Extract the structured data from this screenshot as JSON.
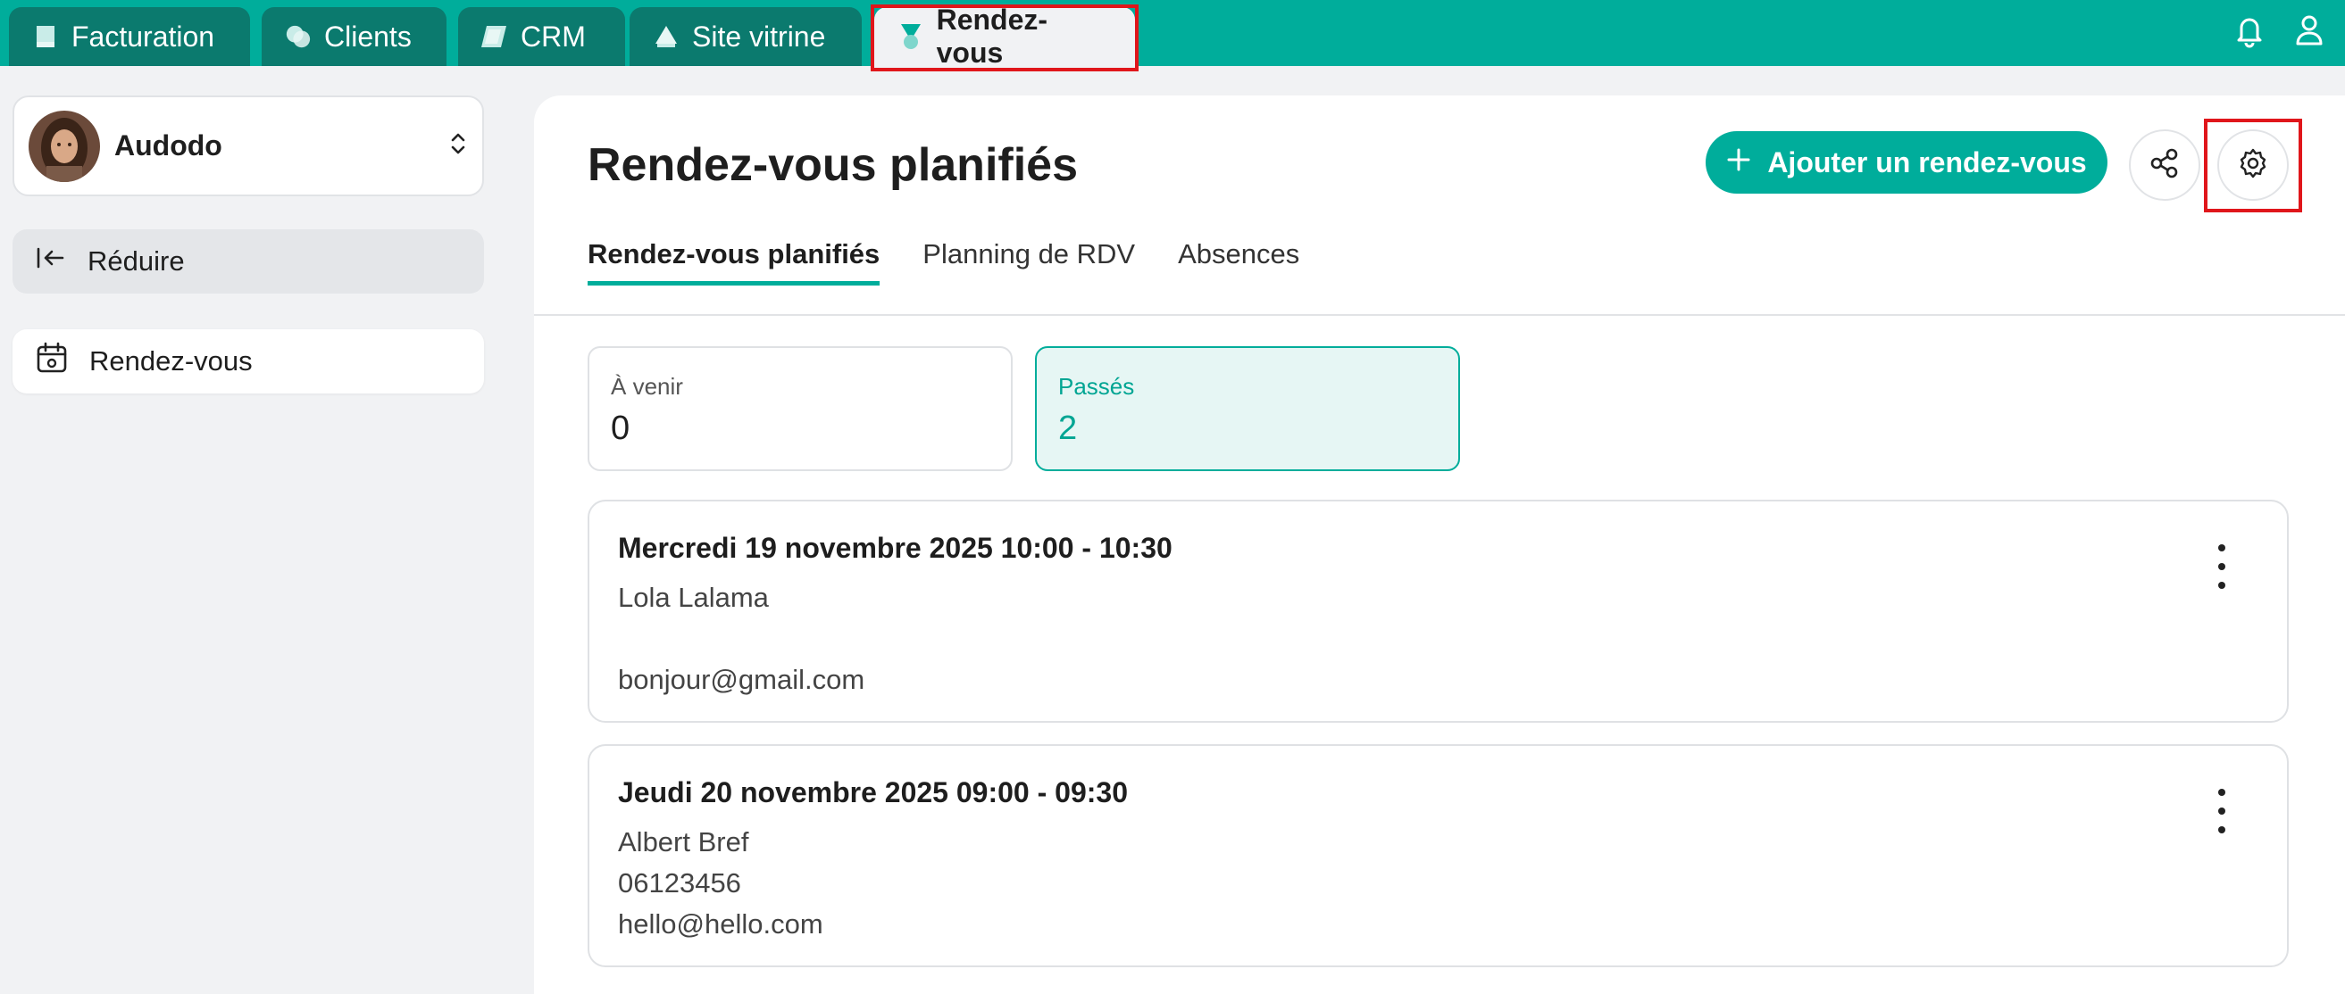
{
  "top_tabs": [
    {
      "label": "Facturation",
      "icon": "invoice-icon"
    },
    {
      "label": "Clients",
      "icon": "clients-icon"
    },
    {
      "label": "CRM",
      "icon": "crm-icon"
    },
    {
      "label": "Site vitrine",
      "icon": "site-icon"
    },
    {
      "label": "Rendez-vous",
      "icon": "appointment-icon",
      "active": true
    }
  ],
  "top_icons": [
    "bell-icon",
    "user-icon"
  ],
  "sidebar": {
    "account_name": "Audodo",
    "reduce_label": "Réduire",
    "items": [
      {
        "label": "Rendez-vous",
        "icon": "calendar-icon"
      }
    ]
  },
  "main": {
    "title": "Rendez-vous planifiés",
    "add_button": "Ajouter un rendez-vous",
    "tabs": [
      "Rendez-vous planifiés",
      "Planning de RDV",
      "Absences"
    ],
    "stats": [
      {
        "label": "À venir",
        "value": "0"
      },
      {
        "label": "Passés",
        "value": "2",
        "active": true
      }
    ],
    "appointments": [
      {
        "when": "Mercredi 19 novembre 2025 10:00 - 10:30",
        "name": "Lola Lalama",
        "phone": "",
        "email": "bonjour@gmail.com"
      },
      {
        "when": "Jeudi 20 novembre 2025 09:00 - 09:30",
        "name": "Albert Bref",
        "phone": "06123456",
        "email": "hello@hello.com"
      }
    ]
  },
  "colors": {
    "accent": "#00ad9b",
    "accent_dark": "#0b7a6e",
    "highlight": "#e0161b"
  }
}
